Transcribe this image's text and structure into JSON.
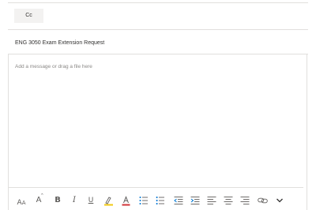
{
  "cc": {
    "label": "Cc"
  },
  "subject": {
    "value": "ENG 3050 Exam Extension Request"
  },
  "message": {
    "placeholder": "Add a message or drag a file here"
  },
  "toolbar": {
    "font_size_icon": "font-size-icon",
    "grow_font_icon": "grow-font-icon",
    "bold_glyph": "B",
    "italic_glyph": "I",
    "underline_glyph": "U",
    "highlight_icon": "highlight-icon",
    "font_color_glyph": "A",
    "highlight_color": "#f2c811",
    "font_color": "#d13438",
    "icon_color": "#605e5c",
    "buttons": [
      "font-size-icon",
      "grow-font-icon",
      "bold-icon",
      "italic-icon",
      "underline-icon",
      "highlight-icon",
      "font-color-icon",
      "bullet-list-icon",
      "numbered-list-icon",
      "decrease-indent-icon",
      "increase-indent-icon",
      "align-left-icon",
      "align-center-icon",
      "align-right-icon",
      "link-icon",
      "more-options-chevron-icon"
    ]
  }
}
